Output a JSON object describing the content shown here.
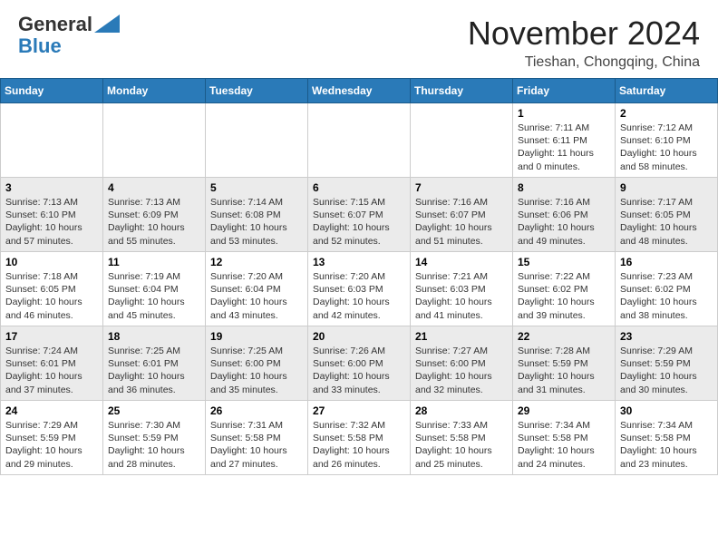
{
  "header": {
    "logo_general": "General",
    "logo_blue": "Blue",
    "month": "November 2024",
    "location": "Tieshan, Chongqing, China"
  },
  "weekdays": [
    "Sunday",
    "Monday",
    "Tuesday",
    "Wednesday",
    "Thursday",
    "Friday",
    "Saturday"
  ],
  "weeks": [
    [
      {
        "day": "",
        "info": ""
      },
      {
        "day": "",
        "info": ""
      },
      {
        "day": "",
        "info": ""
      },
      {
        "day": "",
        "info": ""
      },
      {
        "day": "",
        "info": ""
      },
      {
        "day": "1",
        "info": "Sunrise: 7:11 AM\nSunset: 6:11 PM\nDaylight: 11 hours\nand 0 minutes."
      },
      {
        "day": "2",
        "info": "Sunrise: 7:12 AM\nSunset: 6:10 PM\nDaylight: 10 hours\nand 58 minutes."
      }
    ],
    [
      {
        "day": "3",
        "info": "Sunrise: 7:13 AM\nSunset: 6:10 PM\nDaylight: 10 hours\nand 57 minutes."
      },
      {
        "day": "4",
        "info": "Sunrise: 7:13 AM\nSunset: 6:09 PM\nDaylight: 10 hours\nand 55 minutes."
      },
      {
        "day": "5",
        "info": "Sunrise: 7:14 AM\nSunset: 6:08 PM\nDaylight: 10 hours\nand 53 minutes."
      },
      {
        "day": "6",
        "info": "Sunrise: 7:15 AM\nSunset: 6:07 PM\nDaylight: 10 hours\nand 52 minutes."
      },
      {
        "day": "7",
        "info": "Sunrise: 7:16 AM\nSunset: 6:07 PM\nDaylight: 10 hours\nand 51 minutes."
      },
      {
        "day": "8",
        "info": "Sunrise: 7:16 AM\nSunset: 6:06 PM\nDaylight: 10 hours\nand 49 minutes."
      },
      {
        "day": "9",
        "info": "Sunrise: 7:17 AM\nSunset: 6:05 PM\nDaylight: 10 hours\nand 48 minutes."
      }
    ],
    [
      {
        "day": "10",
        "info": "Sunrise: 7:18 AM\nSunset: 6:05 PM\nDaylight: 10 hours\nand 46 minutes."
      },
      {
        "day": "11",
        "info": "Sunrise: 7:19 AM\nSunset: 6:04 PM\nDaylight: 10 hours\nand 45 minutes."
      },
      {
        "day": "12",
        "info": "Sunrise: 7:20 AM\nSunset: 6:04 PM\nDaylight: 10 hours\nand 43 minutes."
      },
      {
        "day": "13",
        "info": "Sunrise: 7:20 AM\nSunset: 6:03 PM\nDaylight: 10 hours\nand 42 minutes."
      },
      {
        "day": "14",
        "info": "Sunrise: 7:21 AM\nSunset: 6:03 PM\nDaylight: 10 hours\nand 41 minutes."
      },
      {
        "day": "15",
        "info": "Sunrise: 7:22 AM\nSunset: 6:02 PM\nDaylight: 10 hours\nand 39 minutes."
      },
      {
        "day": "16",
        "info": "Sunrise: 7:23 AM\nSunset: 6:02 PM\nDaylight: 10 hours\nand 38 minutes."
      }
    ],
    [
      {
        "day": "17",
        "info": "Sunrise: 7:24 AM\nSunset: 6:01 PM\nDaylight: 10 hours\nand 37 minutes."
      },
      {
        "day": "18",
        "info": "Sunrise: 7:25 AM\nSunset: 6:01 PM\nDaylight: 10 hours\nand 36 minutes."
      },
      {
        "day": "19",
        "info": "Sunrise: 7:25 AM\nSunset: 6:00 PM\nDaylight: 10 hours\nand 35 minutes."
      },
      {
        "day": "20",
        "info": "Sunrise: 7:26 AM\nSunset: 6:00 PM\nDaylight: 10 hours\nand 33 minutes."
      },
      {
        "day": "21",
        "info": "Sunrise: 7:27 AM\nSunset: 6:00 PM\nDaylight: 10 hours\nand 32 minutes."
      },
      {
        "day": "22",
        "info": "Sunrise: 7:28 AM\nSunset: 5:59 PM\nDaylight: 10 hours\nand 31 minutes."
      },
      {
        "day": "23",
        "info": "Sunrise: 7:29 AM\nSunset: 5:59 PM\nDaylight: 10 hours\nand 30 minutes."
      }
    ],
    [
      {
        "day": "24",
        "info": "Sunrise: 7:29 AM\nSunset: 5:59 PM\nDaylight: 10 hours\nand 29 minutes."
      },
      {
        "day": "25",
        "info": "Sunrise: 7:30 AM\nSunset: 5:59 PM\nDaylight: 10 hours\nand 28 minutes."
      },
      {
        "day": "26",
        "info": "Sunrise: 7:31 AM\nSunset: 5:58 PM\nDaylight: 10 hours\nand 27 minutes."
      },
      {
        "day": "27",
        "info": "Sunrise: 7:32 AM\nSunset: 5:58 PM\nDaylight: 10 hours\nand 26 minutes."
      },
      {
        "day": "28",
        "info": "Sunrise: 7:33 AM\nSunset: 5:58 PM\nDaylight: 10 hours\nand 25 minutes."
      },
      {
        "day": "29",
        "info": "Sunrise: 7:34 AM\nSunset: 5:58 PM\nDaylight: 10 hours\nand 24 minutes."
      },
      {
        "day": "30",
        "info": "Sunrise: 7:34 AM\nSunset: 5:58 PM\nDaylight: 10 hours\nand 23 minutes."
      }
    ]
  ]
}
